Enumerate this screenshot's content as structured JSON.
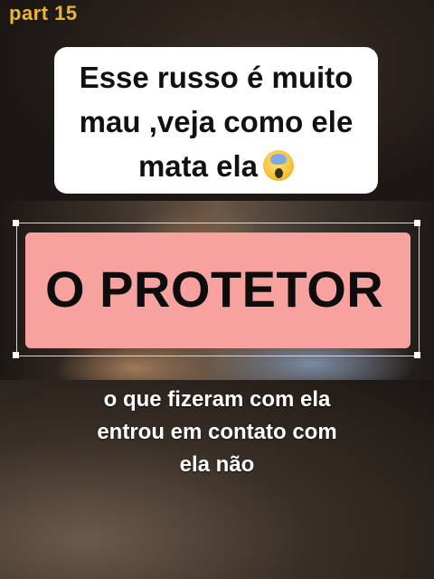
{
  "part_label": "part 15",
  "title_card": {
    "line1": "Esse russo é muito",
    "line2": "mau ,veja como ele",
    "line3": "mata ela",
    "emoji": "face-screaming-in-fear-icon"
  },
  "banner": {
    "text": "O PROTETOR",
    "color": "#f8a2a0"
  },
  "subtitle": {
    "line1": "o que fizeram com ela",
    "line2": "entrou em contato com",
    "line3": "ela não"
  },
  "colors": {
    "part_label": "#e9b730",
    "card_background": "#ffffff",
    "subtitle_text": "#ffffff"
  }
}
